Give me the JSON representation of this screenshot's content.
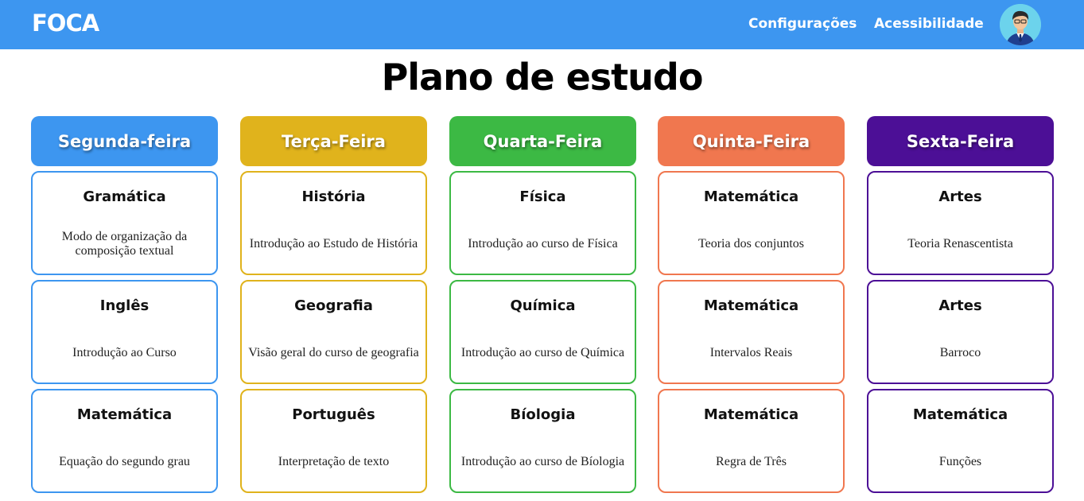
{
  "navbar": {
    "brand": "FOCA",
    "links": [
      {
        "label": "Configurações"
      },
      {
        "label": "Acessibilidade"
      }
    ],
    "color": "#3d96f0"
  },
  "page": {
    "title": "Plano de estudo"
  },
  "days": [
    {
      "name": "Segunda-feira",
      "color": "#3d96f0",
      "subjects": [
        {
          "title": "Gramática",
          "description": "Modo de organização da composição textual"
        },
        {
          "title": "Inglês",
          "description": "Introdução ao Curso"
        },
        {
          "title": "Matemática",
          "description": "Equação do segundo grau"
        }
      ]
    },
    {
      "name": "Terça-Feira",
      "color": "#e0b31c",
      "subjects": [
        {
          "title": "História",
          "description": "Introdução ao Estudo de História"
        },
        {
          "title": "Geografia",
          "description": "Visão geral do curso de geografia"
        },
        {
          "title": "Português",
          "description": "Interpretação de texto"
        }
      ]
    },
    {
      "name": "Quarta-Feira",
      "color": "#3cb944",
      "subjects": [
        {
          "title": "Física",
          "description": "Introdução ao curso de Física"
        },
        {
          "title": "Química",
          "description": "Introdução ao curso de Química"
        },
        {
          "title": "Bíologia",
          "description": "Introdução ao curso de Bíologia"
        }
      ]
    },
    {
      "name": "Quinta-Feira",
      "color": "#f0774f",
      "subjects": [
        {
          "title": "Matemática",
          "description": "Teoria dos conjuntos"
        },
        {
          "title": "Matemática",
          "description": "Intervalos Reais"
        },
        {
          "title": "Matemática",
          "description": "Regra de Três"
        }
      ]
    },
    {
      "name": "Sexta-Feira",
      "color": "#4c0f96",
      "subjects": [
        {
          "title": "Artes",
          "description": "Teoria Renascentista"
        },
        {
          "title": "Artes",
          "description": "Barroco"
        },
        {
          "title": "Matemática",
          "description": "Funções"
        }
      ]
    }
  ]
}
